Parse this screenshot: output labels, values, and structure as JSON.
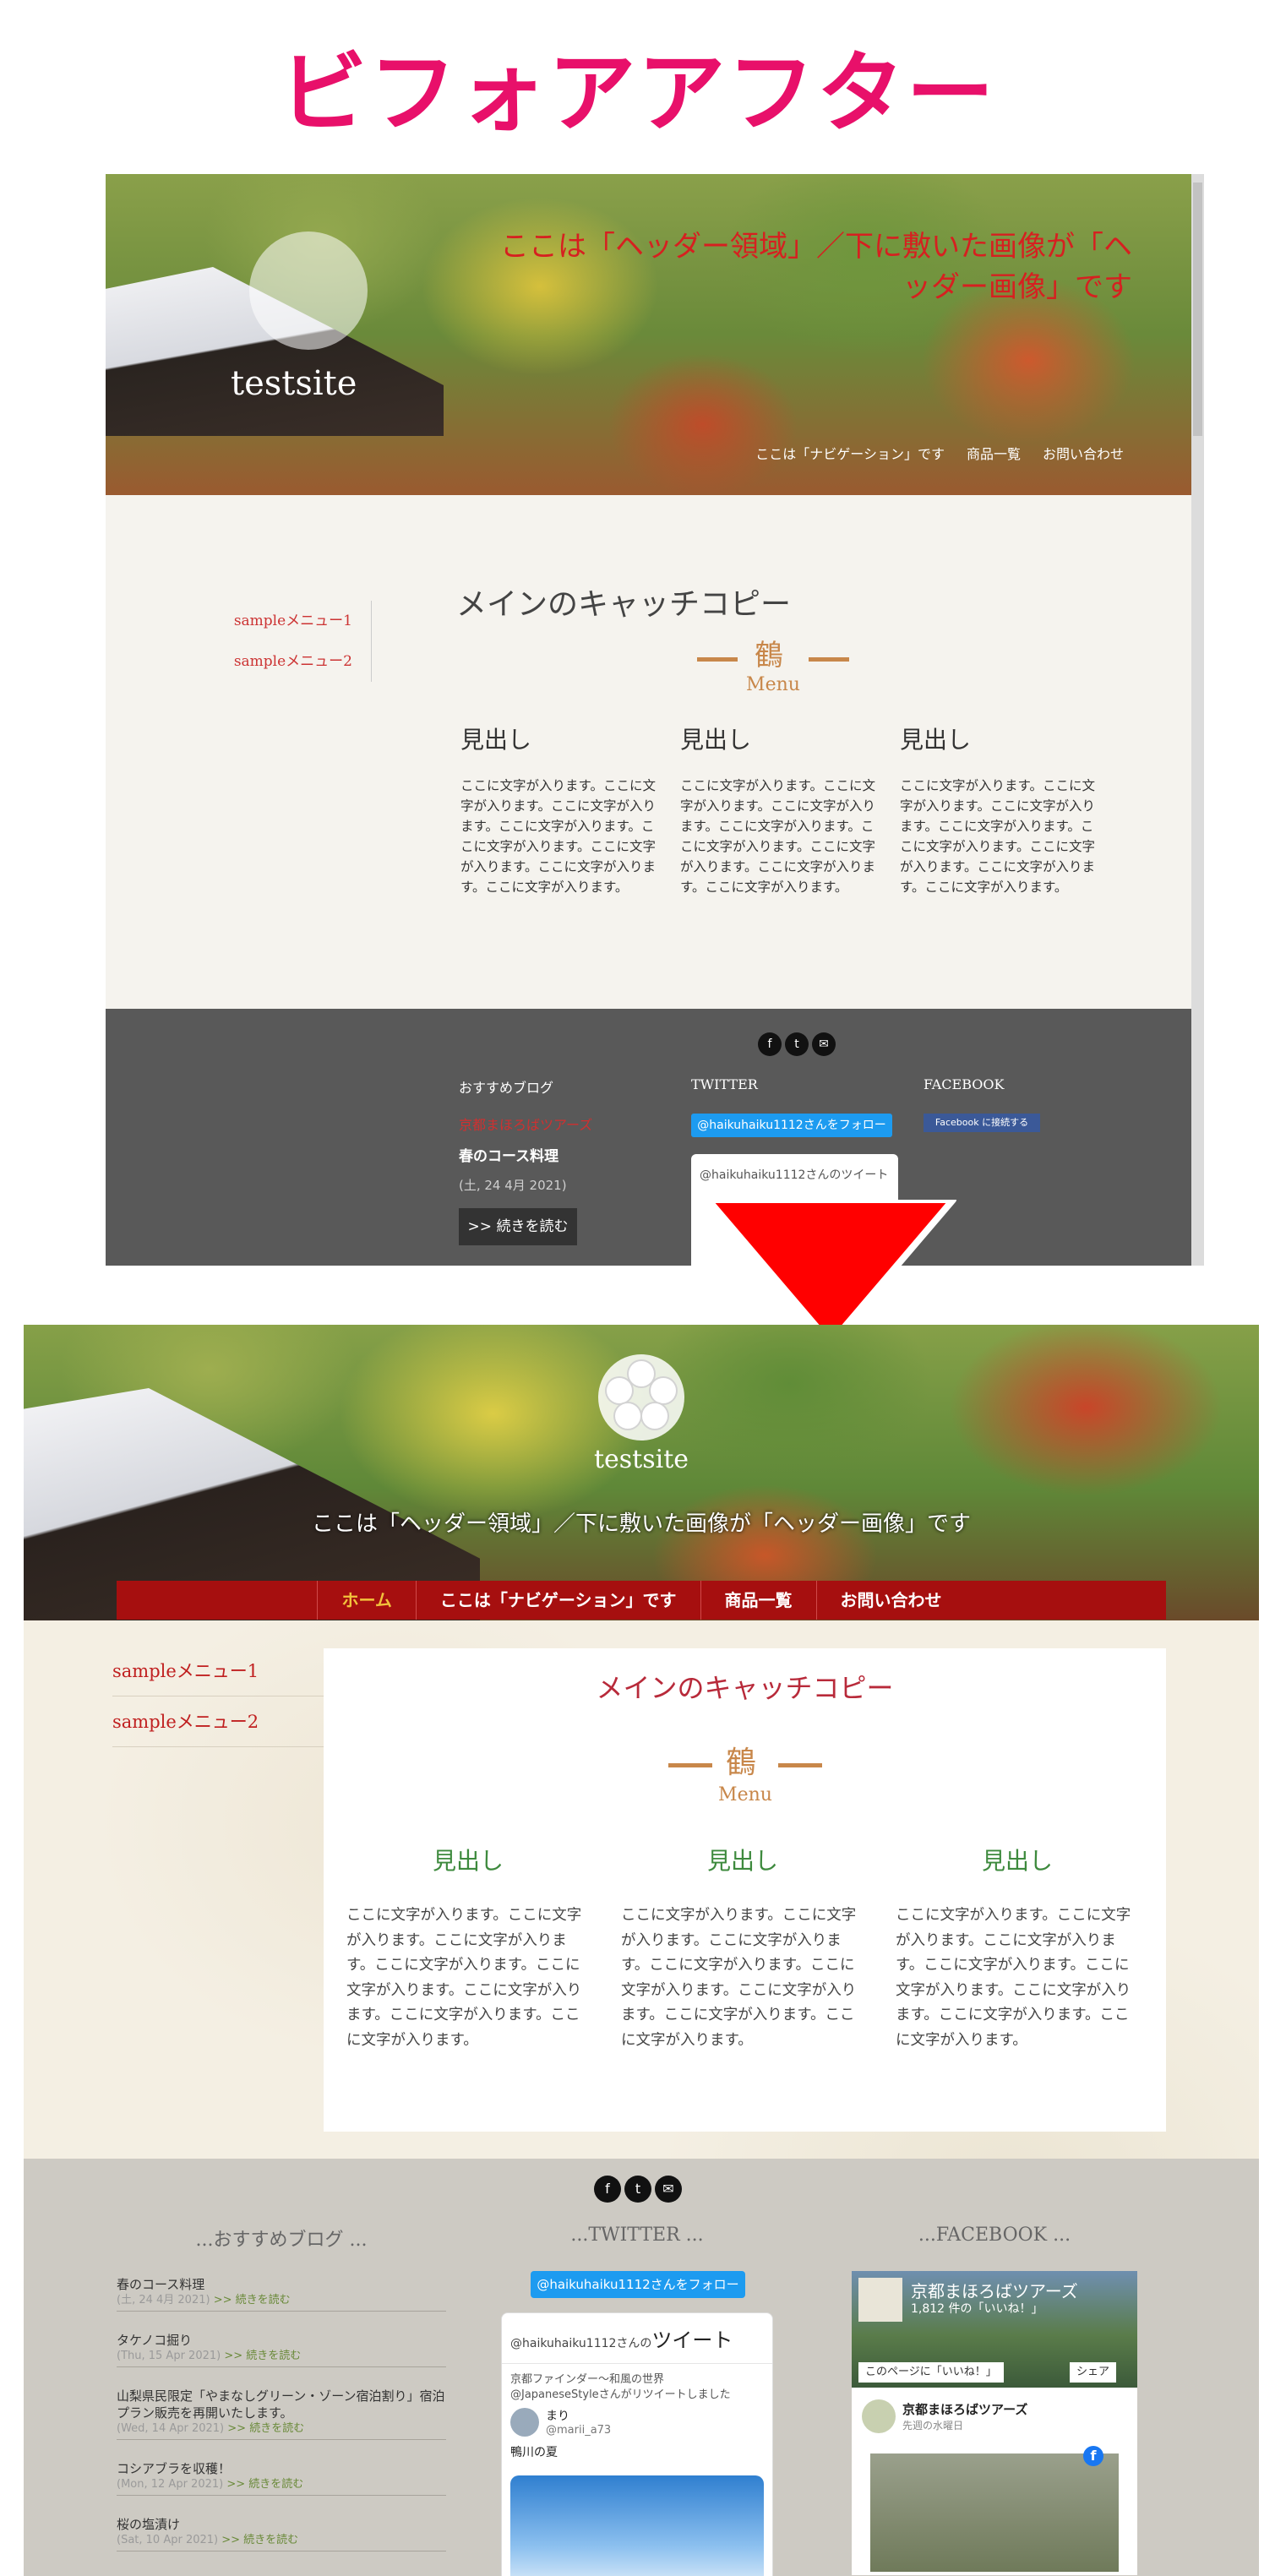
{
  "title": "ビフォアアフター",
  "before": {
    "site_name": "testsite",
    "header_text": "ここは「ヘッダー領域」／下に敷いた画像が「ヘッダー画像」です",
    "nav": [
      "ここは「ナビゲーション」です",
      "商品一覧",
      "お問い合わせ"
    ],
    "side_menu": [
      "sampleメニュー1",
      "sampleメニュー2"
    ],
    "catch_copy": "メインのキャッチコピー",
    "ornament_word": "Menu",
    "columns": [
      {
        "heading": "見出し",
        "text": "ここに文字が入ります。ここに文字が入ります。ここに文字が入ります。ここに文字が入ります。ここに文字が入ります。ここに文字が入ります。ここに文字が入ります。ここに文字が入ります。"
      },
      {
        "heading": "見出し",
        "text": "ここに文字が入ります。ここに文字が入ります。ここに文字が入ります。ここに文字が入ります。ここに文字が入ります。ここに文字が入ります。ここに文字が入ります。ここに文字が入ります。"
      },
      {
        "heading": "見出し",
        "text": "ここに文字が入ります。ここに文字が入ります。ここに文字が入ります。ここに文字が入ります。ここに文字が入ります。ここに文字が入ります。ここに文字が入ります。ここに文字が入ります。"
      }
    ],
    "footer": {
      "blog_title": "おすすめブログ",
      "blog_link": "京都まほろばツアーズ",
      "blog_post": "春のコース料理",
      "blog_date": "(土, 24 4月 2021)",
      "read_more": ">> 続きを読む",
      "twitter_title": "TWITTER",
      "twitter_follow": "@haikuhaiku1112さんをフォロー",
      "twitter_widget_head": "@haikuhaiku1112さんのツイート",
      "facebook_title": "FACEBOOK",
      "facebook_connect": "Facebook に接続する"
    }
  },
  "after": {
    "site_name": "testsite",
    "header_text": "ここは「ヘッダー領域」／下に敷いた画像が「ヘッダー画像」です",
    "nav": [
      "ホーム",
      "ここは「ナビゲーション」です",
      "商品一覧",
      "お問い合わせ"
    ],
    "side_menu": [
      "sampleメニュー1",
      "sampleメニュー2"
    ],
    "catch_copy": "メインのキャッチコピー",
    "ornament_word": "Menu",
    "columns": [
      {
        "heading": "見出し",
        "text": "ここに文字が入ります。ここに文字が入ります。ここに文字が入ります。ここに文字が入ります。ここに文字が入ります。ここに文字が入ります。ここに文字が入ります。ここに文字が入ります。"
      },
      {
        "heading": "見出し",
        "text": "ここに文字が入ります。ここに文字が入ります。ここに文字が入ります。ここに文字が入ります。ここに文字が入ります。ここに文字が入ります。ここに文字が入ります。ここに文字が入ります。"
      },
      {
        "heading": "見出し",
        "text": "ここに文字が入ります。ここに文字が入ります。ここに文字が入ります。ここに文字が入ります。ここに文字が入ります。ここに文字が入ります。ここに文字が入ります。ここに文字が入ります。"
      }
    ],
    "footer": {
      "blog_title": "...おすすめブログ ...",
      "twitter_title": "...TWITTER ...",
      "facebook_title": "...FACEBOOK ...",
      "blog_posts": [
        {
          "title": "春のコース料理",
          "date": "(土, 24 4月 2021)",
          "read_more": ">> 続きを読む"
        },
        {
          "title": "タケノコ掘り",
          "date": "(Thu, 15 Apr 2021)",
          "read_more": ">> 続きを読む"
        },
        {
          "title": "山梨県民限定「やまなしグリーン・ゾーン宿泊割り」宿泊プラン販売を再開いたします。",
          "date": "(Wed, 14 Apr 2021)",
          "read_more": ">> 続きを読む"
        },
        {
          "title": "コシアブラを収穫！",
          "date": "(Mon, 12 Apr 2021)",
          "read_more": ">> 続きを読む"
        },
        {
          "title": "桜の塩漬け",
          "date": "(Sat, 10 Apr 2021)",
          "read_more": ">> 続きを読む"
        }
      ],
      "twitter_follow": "@haikuhaiku1112さんをフォロー",
      "twitter_widget_handle": "@haikuhaiku1112さんの",
      "twitter_widget_word": "ツイート",
      "twitter_retweet_line1": "京都ファインダー〜和風の世界",
      "twitter_retweet_line2": "@JapaneseStyleさんがリツイートしました",
      "twitter_user_name": "まり",
      "twitter_user_handle": "@marii_a73",
      "twitter_text": "鴨川の夏",
      "fb_page_name": "京都まほろばツアーズ",
      "fb_likes": "1,812 件の「いいね！」",
      "fb_like_button": "このページに「いいね！」",
      "fb_share_button": "シェア",
      "fb_post_name": "京都まほろばツアーズ",
      "fb_post_time": "先週の水曜日"
    }
  },
  "colors": {
    "title": "#e8106a",
    "nav_bg": "#a60f0f",
    "catch": "#b82a3a",
    "heading": "#3e8a3e",
    "ornament": "#c8874a",
    "arrow": "#ff0000"
  }
}
